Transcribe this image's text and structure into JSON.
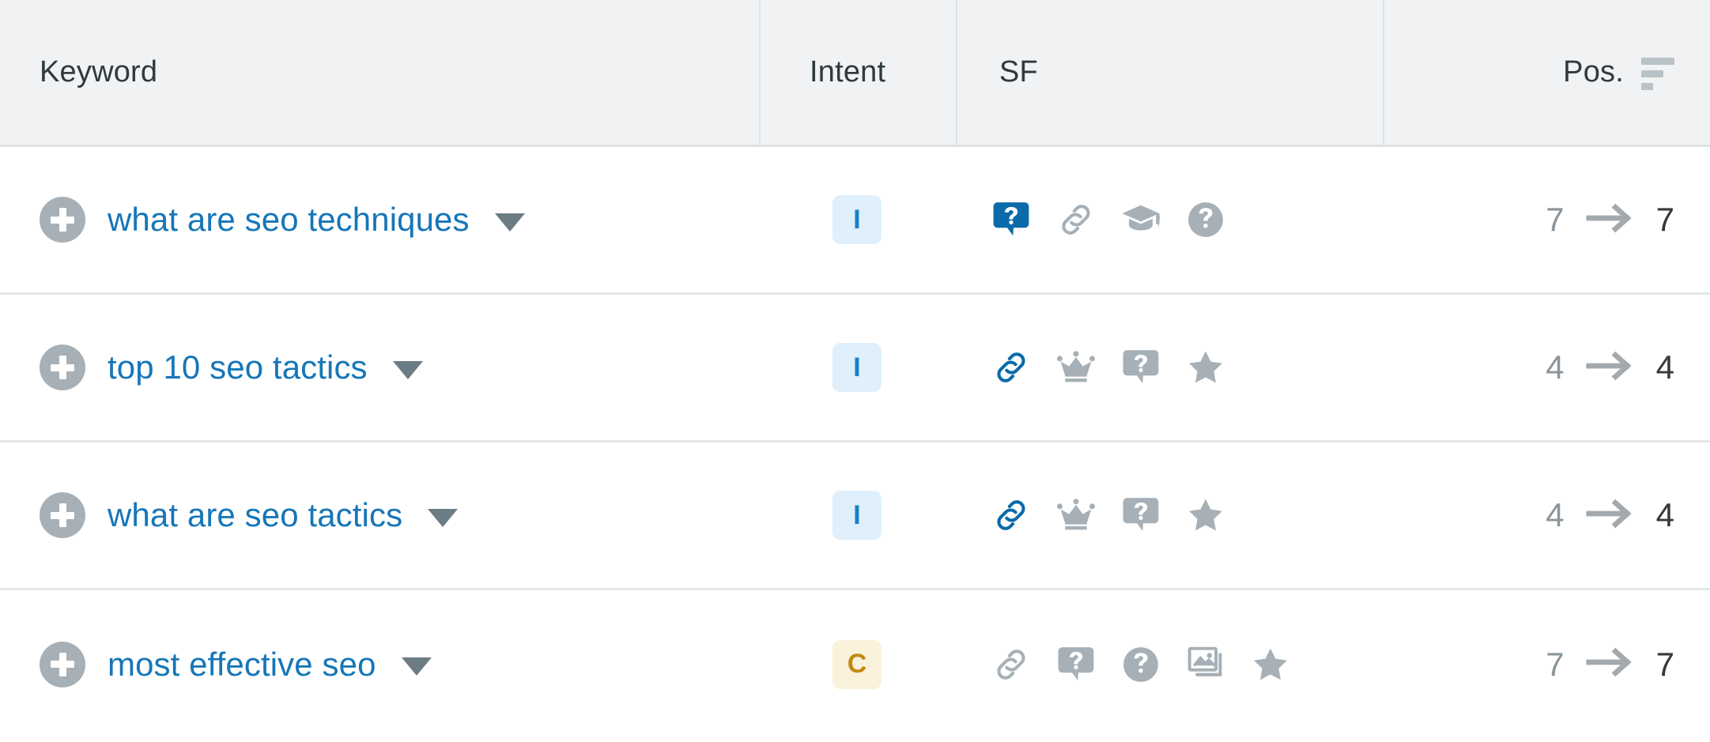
{
  "colors": {
    "header_bg": "#f0f2f4",
    "link_blue": "#1676b8",
    "icon_gray": "#a6b0b6",
    "accent_blue": "#0b6aaa",
    "intent_informational_bg": "#dfeffb",
    "intent_informational_fg": "#1781c6",
    "intent_commercial_bg": "#fbf2dc",
    "intent_commercial_fg": "#c08a12",
    "row_border": "#e3e8eb"
  },
  "header": {
    "keyword": "Keyword",
    "intent": "Intent",
    "sf": "SF",
    "position": "Pos.",
    "sort_icon": "sort-descending-icon",
    "sort_state": "descending"
  },
  "rows": [
    {
      "add_button": "add-keyword-button",
      "keyword": "what are seo techniques",
      "dropdown": "chevron-down-icon",
      "intent": {
        "code": "I",
        "name": "informational"
      },
      "sf": [
        {
          "icon": "featured-snippet-icon",
          "active": true
        },
        {
          "icon": "sitelinks-icon",
          "active": false
        },
        {
          "icon": "knowledge-panel-icon",
          "active": false
        },
        {
          "icon": "people-also-ask-icon",
          "active": false
        }
      ],
      "pos_old": "7",
      "pos_new": "7"
    },
    {
      "add_button": "add-keyword-button",
      "keyword": "top 10 seo tactics",
      "dropdown": "chevron-down-icon",
      "intent": {
        "code": "I",
        "name": "informational"
      },
      "sf": [
        {
          "icon": "sitelinks-icon",
          "active": true
        },
        {
          "icon": "top-stories-icon",
          "active": false
        },
        {
          "icon": "featured-snippet-icon",
          "active": false
        },
        {
          "icon": "reviews-icon",
          "active": false
        }
      ],
      "pos_old": "4",
      "pos_new": "4"
    },
    {
      "add_button": "add-keyword-button",
      "keyword": "what are seo tactics",
      "dropdown": "chevron-down-icon",
      "intent": {
        "code": "I",
        "name": "informational"
      },
      "sf": [
        {
          "icon": "sitelinks-icon",
          "active": true
        },
        {
          "icon": "top-stories-icon",
          "active": false
        },
        {
          "icon": "featured-snippet-icon",
          "active": false
        },
        {
          "icon": "reviews-icon",
          "active": false
        }
      ],
      "pos_old": "4",
      "pos_new": "4"
    },
    {
      "add_button": "add-keyword-button",
      "keyword": "most effective seo",
      "dropdown": "chevron-down-icon",
      "intent": {
        "code": "C",
        "name": "commercial"
      },
      "sf": [
        {
          "icon": "sitelinks-icon",
          "active": false
        },
        {
          "icon": "featured-snippet-icon",
          "active": false
        },
        {
          "icon": "people-also-ask-icon",
          "active": false
        },
        {
          "icon": "image-pack-icon",
          "active": false
        },
        {
          "icon": "reviews-icon",
          "active": false
        }
      ],
      "pos_old": "7",
      "pos_new": "7"
    }
  ]
}
